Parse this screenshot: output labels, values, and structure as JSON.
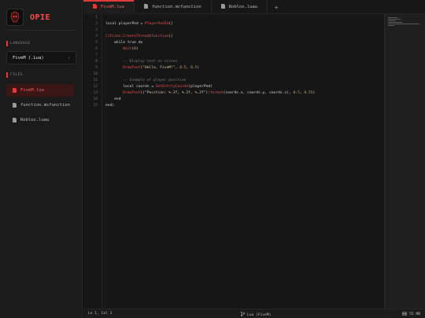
{
  "app": {
    "name": "OPIE"
  },
  "sidebar": {
    "language_label": "LANGUAGE",
    "language_value": "FiveM (.Lua)",
    "files_label": "FILES",
    "files": [
      {
        "name": "FiveM.lua",
        "active": true
      },
      {
        "name": "function.mcfunction",
        "active": false
      },
      {
        "name": "Roblox.luau",
        "active": false
      }
    ]
  },
  "tabs": [
    {
      "label": "FiveM.lua",
      "active": true
    },
    {
      "label": "function.mcfunction",
      "active": false
    },
    {
      "label": "Roblox.luau",
      "active": false
    }
  ],
  "add_tab": "+",
  "editor": {
    "lines": [
      {
        "n": "1",
        "text": ""
      },
      {
        "n": "2",
        "text": "local playerPed = PlayerPedId()"
      },
      {
        "n": "3",
        "text": ""
      },
      {
        "n": "4",
        "text": "Citizen.CreateThread(function()"
      },
      {
        "n": "5",
        "text": "    while true do"
      },
      {
        "n": "6",
        "text": "        Wait(0)"
      },
      {
        "n": "7",
        "text": ""
      },
      {
        "n": "8",
        "text": "        -- Display text on screen"
      },
      {
        "n": "9",
        "text": "        DrawText(\"Hello, FiveM!\", 0.5, 0.5)"
      },
      {
        "n": "10",
        "text": ""
      },
      {
        "n": "11",
        "text": "        -- Example of player position"
      },
      {
        "n": "12",
        "text": "        local coords = GetEntityCoords(playerPed)"
      },
      {
        "n": "13",
        "text": "        DrawText((\"Position: %.2f, %.2f, %.2f\"):format(coords.x, coords.y, coords.z), 0.5, 0.55)"
      },
      {
        "n": "14",
        "text": "    end"
      },
      {
        "n": "15",
        "text": "end)"
      }
    ]
  },
  "status": {
    "cursor": "Ln 1, Col 1",
    "language": "Lua (FiveM)",
    "memory": "55 MB"
  },
  "colors": {
    "accent": "#e03a3a",
    "accent_text": "#ff5c5c",
    "background": "#141414"
  }
}
